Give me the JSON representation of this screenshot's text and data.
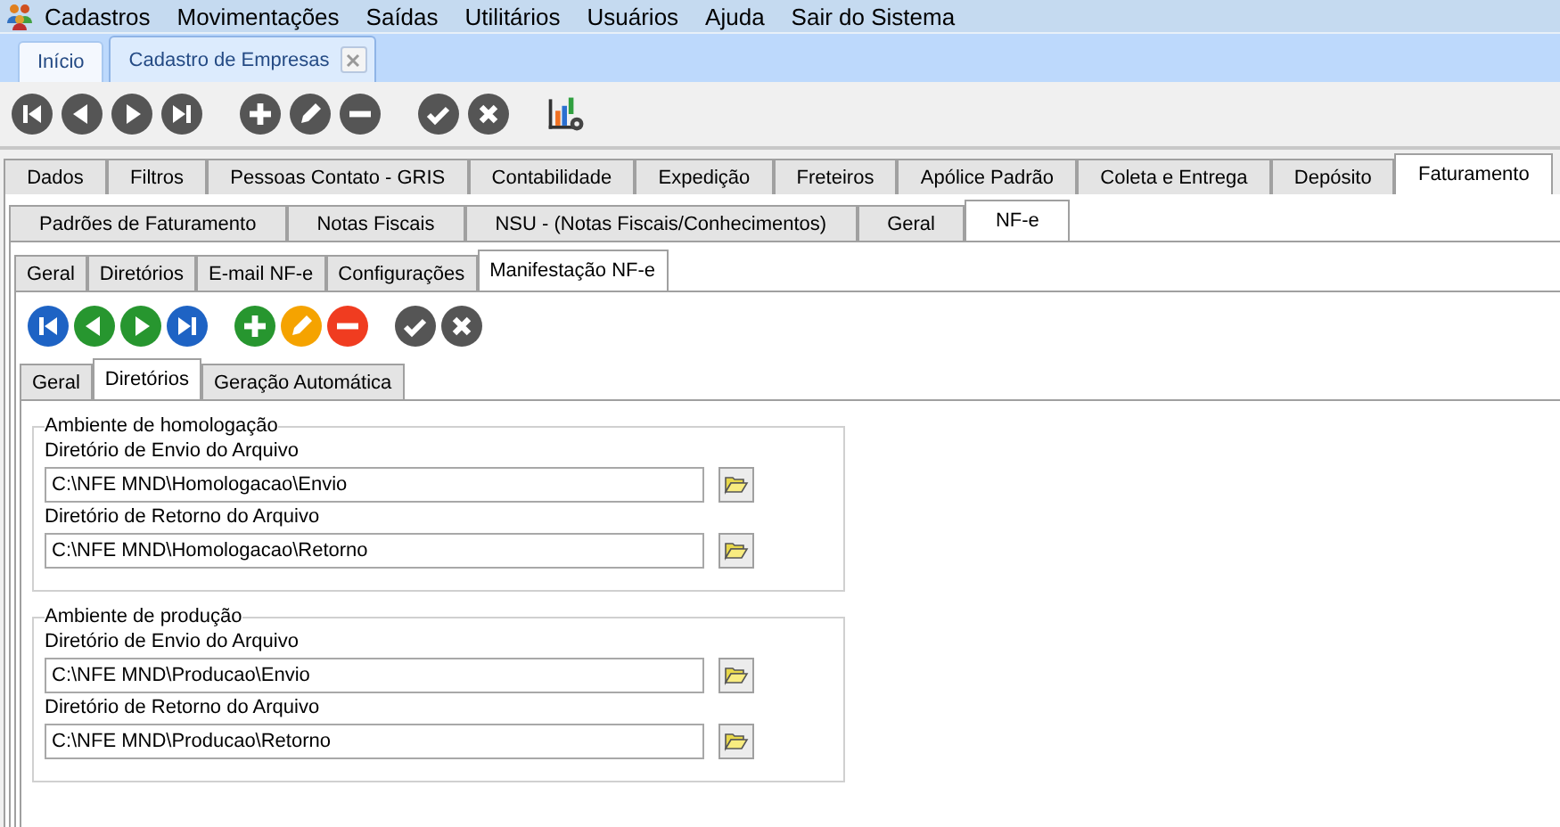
{
  "menu": [
    "Cadastros",
    "Movimentações",
    "Saídas",
    "Utilitários",
    "Usuários",
    "Ajuda",
    "Sair do Sistema"
  ],
  "doc_tabs": [
    {
      "label": "Início",
      "selected": false,
      "closable": false
    },
    {
      "label": "Cadastro de Empresas",
      "selected": true,
      "closable": true
    }
  ],
  "main_toolbar": [
    {
      "kind": "first"
    },
    {
      "kind": "prev"
    },
    {
      "kind": "next"
    },
    {
      "kind": "last"
    },
    {
      "kind": "add"
    },
    {
      "kind": "edit"
    },
    {
      "kind": "delete"
    },
    {
      "kind": "confirm"
    },
    {
      "kind": "cancel"
    },
    {
      "kind": "report"
    }
  ],
  "tabs": [
    {
      "label": "Dados",
      "selected": false
    },
    {
      "label": "Filtros",
      "selected": false
    },
    {
      "label": "Pessoas Contato - GRIS",
      "selected": false
    },
    {
      "label": "Contabilidade",
      "selected": false
    },
    {
      "label": "Expedição",
      "selected": false
    },
    {
      "label": "Freteiros",
      "selected": false
    },
    {
      "label": "Apólice Padrão",
      "selected": false
    },
    {
      "label": "Coleta e Entrega",
      "selected": false
    },
    {
      "label": "Depósito",
      "selected": false
    },
    {
      "label": "Faturamento",
      "selected": true
    }
  ],
  "sub_tabs": [
    {
      "label": "Padrões de Faturamento",
      "selected": false
    },
    {
      "label": "Notas Fiscais",
      "selected": false
    },
    {
      "label": "NSU - (Notas Fiscais/Conhecimentos)",
      "selected": false
    },
    {
      "label": "Geral",
      "selected": false
    },
    {
      "label": "NF-e",
      "selected": true
    }
  ],
  "nfe_tabs": [
    {
      "label": "Geral",
      "selected": false
    },
    {
      "label": "Diretórios",
      "selected": false
    },
    {
      "label": "E-mail NF-e",
      "selected": false
    },
    {
      "label": "Configurações",
      "selected": false
    },
    {
      "label": "Manifestação NF-e",
      "selected": true
    }
  ],
  "nfe_toolbar": [
    {
      "kind": "first",
      "color": "#1e63c4"
    },
    {
      "kind": "prev",
      "color": "#27962f"
    },
    {
      "kind": "next",
      "color": "#27962f"
    },
    {
      "kind": "last",
      "color": "#1e63c4"
    },
    {
      "kind": "add",
      "color": "#27962f"
    },
    {
      "kind": "edit",
      "color": "#f5a300"
    },
    {
      "kind": "delete",
      "color": "#f03c20"
    },
    {
      "kind": "confirm",
      "color": "#555555"
    },
    {
      "kind": "cancel",
      "color": "#555555"
    }
  ],
  "manifest_tabs": [
    {
      "label": "Geral",
      "selected": false
    },
    {
      "label": "Diretórios",
      "selected": true
    },
    {
      "label": "Geração Automática",
      "selected": false
    }
  ],
  "groups": [
    {
      "title": "Ambiente de homologação",
      "fields": [
        {
          "label": "Diretório de Envio do Arquivo",
          "value": "C:\\NFE MND\\Homologacao\\Envio"
        },
        {
          "label": "Diretório de Retorno do Arquivo",
          "value": "C:\\NFE MND\\Homologacao\\Retorno"
        }
      ]
    },
    {
      "title": "Ambiente de produção",
      "fields": [
        {
          "label": "Diretório de Envio do Arquivo",
          "value": "C:\\NFE MND\\Producao\\Envio"
        },
        {
          "label": "Diretório de Retorno do Arquivo",
          "value": "C:\\NFE MND\\Producao\\Retorno"
        }
      ]
    }
  ]
}
